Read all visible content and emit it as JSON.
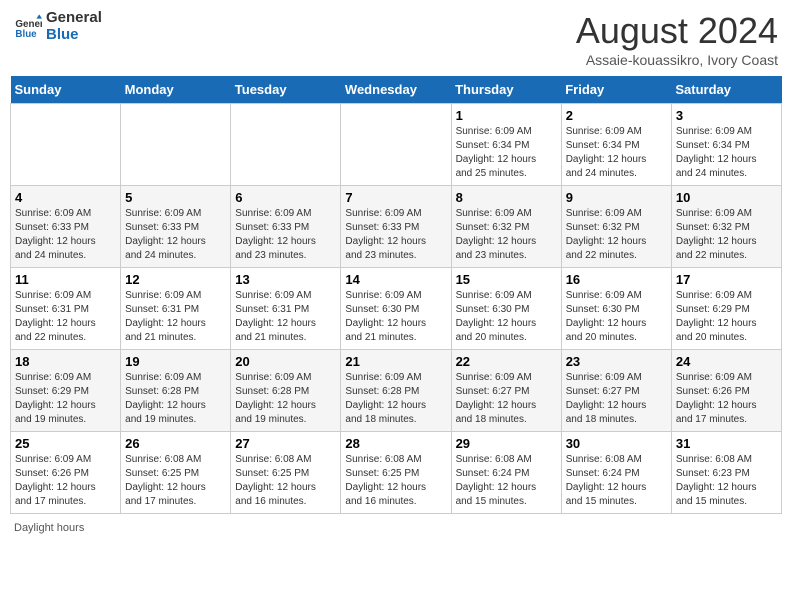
{
  "header": {
    "logo_line1": "General",
    "logo_line2": "Blue",
    "main_title": "August 2024",
    "subtitle": "Assaie-kouassikro, Ivory Coast"
  },
  "days_of_week": [
    "Sunday",
    "Monday",
    "Tuesday",
    "Wednesday",
    "Thursday",
    "Friday",
    "Saturday"
  ],
  "weeks": [
    [
      {
        "day": "",
        "info": ""
      },
      {
        "day": "",
        "info": ""
      },
      {
        "day": "",
        "info": ""
      },
      {
        "day": "",
        "info": ""
      },
      {
        "day": "1",
        "info": "Sunrise: 6:09 AM\nSunset: 6:34 PM\nDaylight: 12 hours\nand 25 minutes."
      },
      {
        "day": "2",
        "info": "Sunrise: 6:09 AM\nSunset: 6:34 PM\nDaylight: 12 hours\nand 24 minutes."
      },
      {
        "day": "3",
        "info": "Sunrise: 6:09 AM\nSunset: 6:34 PM\nDaylight: 12 hours\nand 24 minutes."
      }
    ],
    [
      {
        "day": "4",
        "info": "Sunrise: 6:09 AM\nSunset: 6:33 PM\nDaylight: 12 hours\nand 24 minutes."
      },
      {
        "day": "5",
        "info": "Sunrise: 6:09 AM\nSunset: 6:33 PM\nDaylight: 12 hours\nand 24 minutes."
      },
      {
        "day": "6",
        "info": "Sunrise: 6:09 AM\nSunset: 6:33 PM\nDaylight: 12 hours\nand 23 minutes."
      },
      {
        "day": "7",
        "info": "Sunrise: 6:09 AM\nSunset: 6:33 PM\nDaylight: 12 hours\nand 23 minutes."
      },
      {
        "day": "8",
        "info": "Sunrise: 6:09 AM\nSunset: 6:32 PM\nDaylight: 12 hours\nand 23 minutes."
      },
      {
        "day": "9",
        "info": "Sunrise: 6:09 AM\nSunset: 6:32 PM\nDaylight: 12 hours\nand 22 minutes."
      },
      {
        "day": "10",
        "info": "Sunrise: 6:09 AM\nSunset: 6:32 PM\nDaylight: 12 hours\nand 22 minutes."
      }
    ],
    [
      {
        "day": "11",
        "info": "Sunrise: 6:09 AM\nSunset: 6:31 PM\nDaylight: 12 hours\nand 22 minutes."
      },
      {
        "day": "12",
        "info": "Sunrise: 6:09 AM\nSunset: 6:31 PM\nDaylight: 12 hours\nand 21 minutes."
      },
      {
        "day": "13",
        "info": "Sunrise: 6:09 AM\nSunset: 6:31 PM\nDaylight: 12 hours\nand 21 minutes."
      },
      {
        "day": "14",
        "info": "Sunrise: 6:09 AM\nSunset: 6:30 PM\nDaylight: 12 hours\nand 21 minutes."
      },
      {
        "day": "15",
        "info": "Sunrise: 6:09 AM\nSunset: 6:30 PM\nDaylight: 12 hours\nand 20 minutes."
      },
      {
        "day": "16",
        "info": "Sunrise: 6:09 AM\nSunset: 6:30 PM\nDaylight: 12 hours\nand 20 minutes."
      },
      {
        "day": "17",
        "info": "Sunrise: 6:09 AM\nSunset: 6:29 PM\nDaylight: 12 hours\nand 20 minutes."
      }
    ],
    [
      {
        "day": "18",
        "info": "Sunrise: 6:09 AM\nSunset: 6:29 PM\nDaylight: 12 hours\nand 19 minutes."
      },
      {
        "day": "19",
        "info": "Sunrise: 6:09 AM\nSunset: 6:28 PM\nDaylight: 12 hours\nand 19 minutes."
      },
      {
        "day": "20",
        "info": "Sunrise: 6:09 AM\nSunset: 6:28 PM\nDaylight: 12 hours\nand 19 minutes."
      },
      {
        "day": "21",
        "info": "Sunrise: 6:09 AM\nSunset: 6:28 PM\nDaylight: 12 hours\nand 18 minutes."
      },
      {
        "day": "22",
        "info": "Sunrise: 6:09 AM\nSunset: 6:27 PM\nDaylight: 12 hours\nand 18 minutes."
      },
      {
        "day": "23",
        "info": "Sunrise: 6:09 AM\nSunset: 6:27 PM\nDaylight: 12 hours\nand 18 minutes."
      },
      {
        "day": "24",
        "info": "Sunrise: 6:09 AM\nSunset: 6:26 PM\nDaylight: 12 hours\nand 17 minutes."
      }
    ],
    [
      {
        "day": "25",
        "info": "Sunrise: 6:09 AM\nSunset: 6:26 PM\nDaylight: 12 hours\nand 17 minutes."
      },
      {
        "day": "26",
        "info": "Sunrise: 6:08 AM\nSunset: 6:25 PM\nDaylight: 12 hours\nand 17 minutes."
      },
      {
        "day": "27",
        "info": "Sunrise: 6:08 AM\nSunset: 6:25 PM\nDaylight: 12 hours\nand 16 minutes."
      },
      {
        "day": "28",
        "info": "Sunrise: 6:08 AM\nSunset: 6:25 PM\nDaylight: 12 hours\nand 16 minutes."
      },
      {
        "day": "29",
        "info": "Sunrise: 6:08 AM\nSunset: 6:24 PM\nDaylight: 12 hours\nand 15 minutes."
      },
      {
        "day": "30",
        "info": "Sunrise: 6:08 AM\nSunset: 6:24 PM\nDaylight: 12 hours\nand 15 minutes."
      },
      {
        "day": "31",
        "info": "Sunrise: 6:08 AM\nSunset: 6:23 PM\nDaylight: 12 hours\nand 15 minutes."
      }
    ]
  ],
  "footer": {
    "note": "Daylight hours"
  }
}
